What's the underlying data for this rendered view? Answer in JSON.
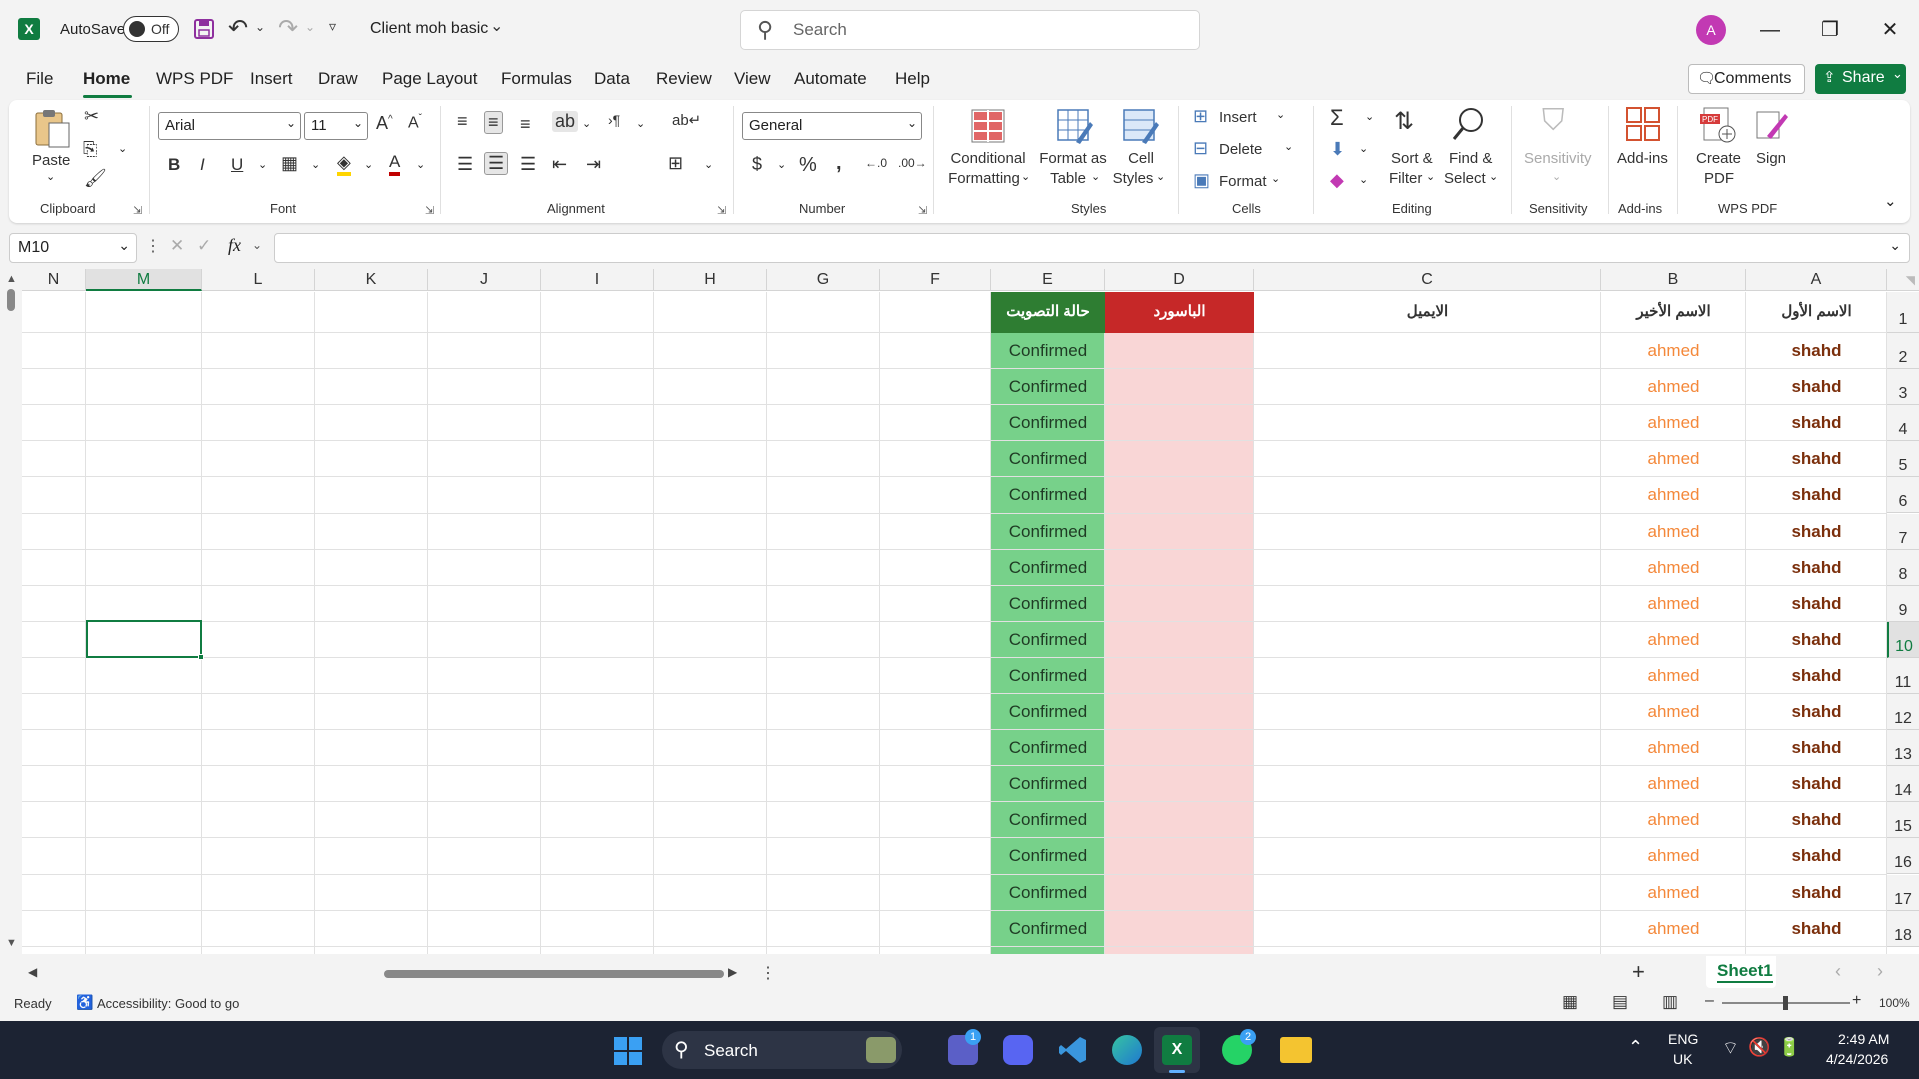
{
  "titlebar": {
    "autosave_label": "AutoSave",
    "autosave_state": "Off",
    "doc_title": "Client moh basic",
    "search_placeholder": "Search",
    "avatar_initial": "A"
  },
  "menu": {
    "tabs": [
      "File",
      "Home",
      "WPS PDF",
      "Insert",
      "Draw",
      "Page Layout",
      "Formulas",
      "Data",
      "Review",
      "View",
      "Automate",
      "Help"
    ],
    "active": "Home",
    "comments": "Comments",
    "share": "Share"
  },
  "ribbon": {
    "clipboard": {
      "paste": "Paste",
      "group": "Clipboard"
    },
    "font": {
      "name": "Arial",
      "size": "11",
      "group": "Font"
    },
    "alignment": {
      "group": "Alignment"
    },
    "number": {
      "format": "General",
      "group": "Number"
    },
    "styles": {
      "conditional": [
        "Conditional",
        "Formatting"
      ],
      "format_table": [
        "Format as",
        "Table"
      ],
      "cell_styles": [
        "Cell",
        "Styles"
      ],
      "group": "Styles"
    },
    "cells": {
      "insert": "Insert",
      "delete": "Delete",
      "format": "Format",
      "group": "Cells"
    },
    "editing": {
      "sort": [
        "Sort &",
        "Filter"
      ],
      "find": [
        "Find &",
        "Select"
      ],
      "group": "Editing"
    },
    "sensitivity": {
      "label": "Sensitivity",
      "group": "Sensitivity"
    },
    "addins": {
      "label": "Add-ins",
      "group": "Add-ins"
    },
    "wps": {
      "create": [
        "Create",
        "PDF"
      ],
      "sign": "Sign",
      "group": "WPS PDF"
    }
  },
  "formula_bar": {
    "name_box": "M10",
    "fx": "fx",
    "value": ""
  },
  "sheet": {
    "columns_visible": [
      "N",
      "M",
      "L",
      "K",
      "J",
      "I",
      "H",
      "G",
      "F",
      "E",
      "D",
      "C",
      "B",
      "A"
    ],
    "selected_column": "M",
    "selected_row": 10,
    "rows": [
      1,
      2,
      3,
      4,
      5,
      6,
      7,
      8,
      9,
      10,
      11,
      12,
      13,
      14,
      15,
      16,
      17,
      18
    ],
    "headers": {
      "A": "الاسم الأول",
      "B": "الاسم الأخير",
      "C": "الايميل",
      "D": "الباسورد",
      "E": "حالة التصويت"
    },
    "data_rows": [
      {
        "A": "shahd",
        "B": "ahmed",
        "E": "Confirmed"
      },
      {
        "A": "shahd",
        "B": "ahmed",
        "E": "Confirmed"
      },
      {
        "A": "shahd",
        "B": "ahmed",
        "E": "Confirmed"
      },
      {
        "A": "shahd",
        "B": "ahmed",
        "E": "Confirmed"
      },
      {
        "A": "shahd",
        "B": "ahmed",
        "E": "Confirmed"
      },
      {
        "A": "shahd",
        "B": "ahmed",
        "E": "Confirmed"
      },
      {
        "A": "shahd",
        "B": "ahmed",
        "E": "Confirmed"
      },
      {
        "A": "shahd",
        "B": "ahmed",
        "E": "Confirmed"
      },
      {
        "A": "shahd",
        "B": "ahmed",
        "E": "Confirmed"
      },
      {
        "A": "shahd",
        "B": "ahmed",
        "E": "Confirmed"
      },
      {
        "A": "shahd",
        "B": "ahmed",
        "E": "Confirmed"
      },
      {
        "A": "shahd",
        "B": "ahmed",
        "E": "Confirmed"
      },
      {
        "A": "shahd",
        "B": "ahmed",
        "E": "Confirmed"
      },
      {
        "A": "shahd",
        "B": "ahmed",
        "E": "Confirmed"
      },
      {
        "A": "shahd",
        "B": "ahmed",
        "E": "Confirmed"
      },
      {
        "A": "shahd",
        "B": "ahmed",
        "E": "Confirmed"
      },
      {
        "A": "shahd",
        "B": "ahmed",
        "E": "Confirmed"
      }
    ],
    "colors": {
      "header_E_bg": "#2e7d32",
      "col_E_bg": "#77d18a",
      "header_D_bg": "#c62828",
      "col_D_bg": "#f9d6d6",
      "col_A_text": "#7b2f0c",
      "col_B_text": "#f4883a",
      "accent": "#107c41"
    }
  },
  "sheet_tabs": {
    "active": "Sheet1"
  },
  "status": {
    "ready": "Ready",
    "accessibility": "Accessibility: Good to go",
    "zoom": "100%"
  },
  "taskbar": {
    "search": "Search",
    "lang": "ENG",
    "region": "UK",
    "time": "2:49 AM",
    "date": "4/24/2026",
    "teams_badge": "1",
    "whatsapp_badge": "2"
  }
}
